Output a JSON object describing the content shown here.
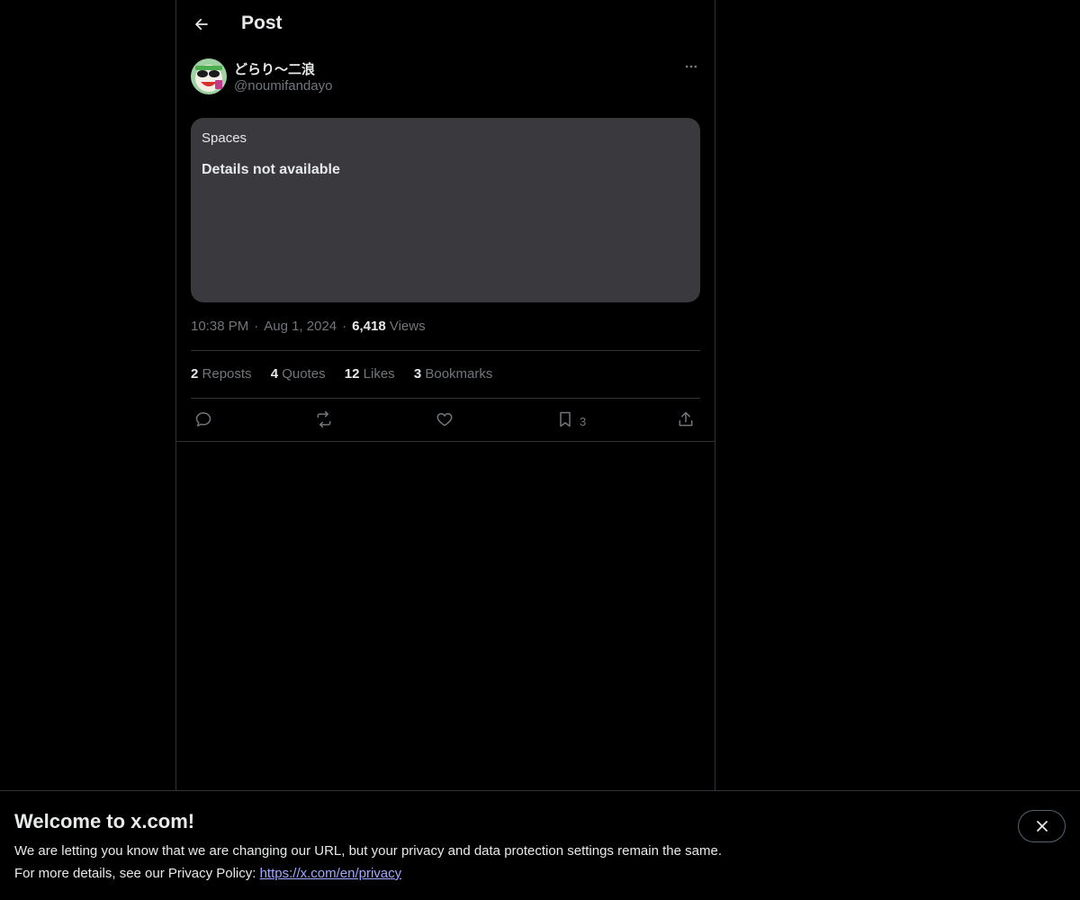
{
  "header": {
    "title": "Post"
  },
  "post": {
    "display_name": "どらり〜二浪",
    "handle": "@noumifandayo",
    "card": {
      "label": "Spaces",
      "status": "Details not available"
    },
    "time": "10:38 PM",
    "separator": "·",
    "date": "Aug 1, 2024",
    "views_count": "6,418",
    "views_label": "Views"
  },
  "stats": {
    "reposts_count": "2",
    "reposts_label": "Repos ts",
    "quotes_count": "4",
    "quotes_label": "Quotes",
    "likes_count": "12",
    "likes_label": "Likes",
    "bookmarks_count": "3",
    "bookmarks_label": "Bookmarks"
  },
  "actions": {
    "bookmark_count": "3"
  },
  "banner": {
    "title": "Welcome to x.com!",
    "line1": "We are letting you know that we are changing our URL, but your privacy and data protection settings remain the same.",
    "line2_prefix": "For more details, see our Privacy Policy: ",
    "link": "https://x.com/en/privacy"
  },
  "icons": {
    "back": "arrow-left-icon",
    "more": "more-dots-icon",
    "reply": "reply-icon",
    "repost": "repost-icon",
    "like": "heart-icon",
    "bookmark": "bookmark-icon",
    "share": "share-icon",
    "close": "close-icon"
  },
  "colors": {
    "background": "#000000",
    "card": "#3a393e",
    "text": "#e7e9ea",
    "muted": "#71767b",
    "link": "#a0a9ff",
    "border": "#2f3336"
  }
}
